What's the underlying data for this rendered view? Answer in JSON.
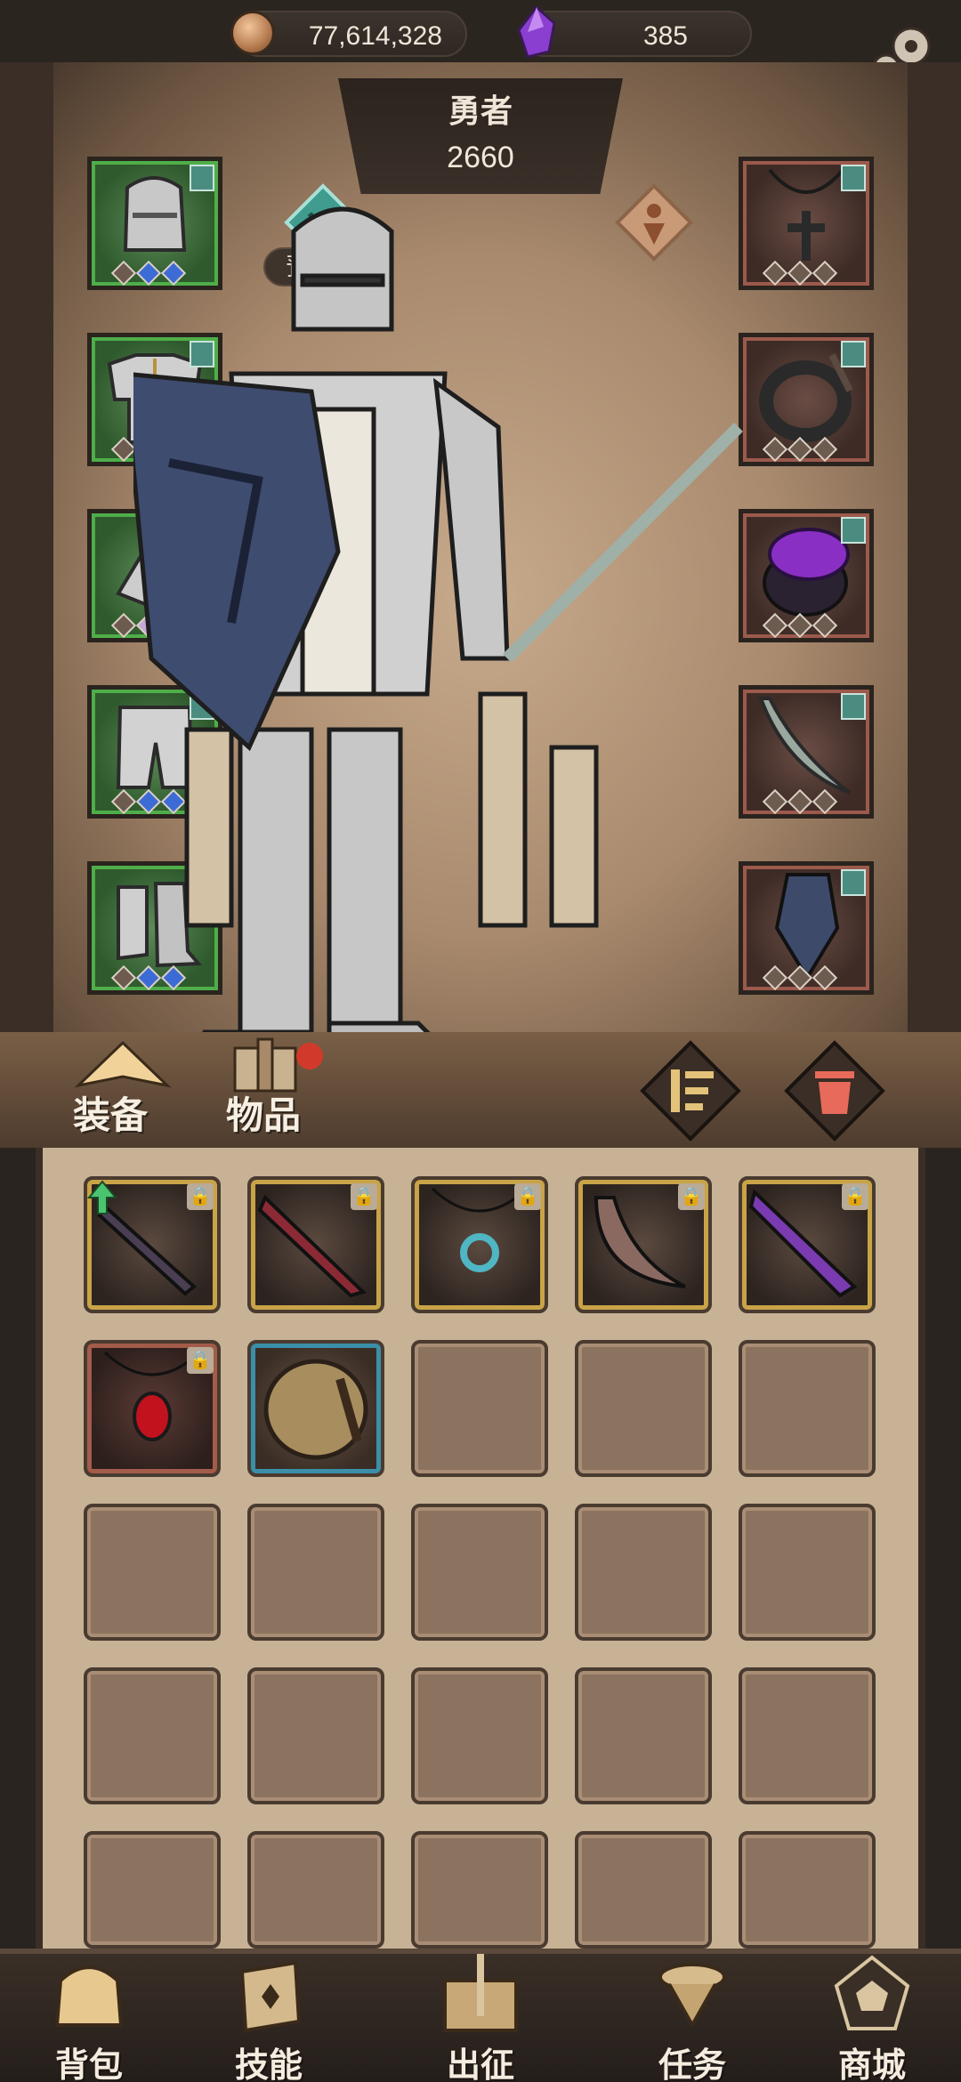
{
  "resources": {
    "gold": "77,614,328",
    "gems": "385"
  },
  "hero": {
    "name": "勇者",
    "power": "2660",
    "preset_label": "预设一"
  },
  "tabs": {
    "equip": "装备",
    "items": "物品"
  },
  "equipment_left": [
    "helmet-icon",
    "chest-armor-icon",
    "gauntlet-icon",
    "leg-armor-icon",
    "boots-icon"
  ],
  "equipment_right": [
    "cross-necklace-icon",
    "chain-ring-icon",
    "purple-gem-ring-icon",
    "curved-blade-icon",
    "shield-icon"
  ],
  "inventory": {
    "items": [
      "dark-sword-icon",
      "serrated-blade-icon",
      "moon-pendant-icon",
      "bloody-scythe-icon",
      "purple-dagger-icon",
      "ruby-pendant-icon",
      "leather-helmet-icon"
    ],
    "empty_slots": 18
  },
  "nav": {
    "bag": "背包",
    "skills": "技能",
    "expedition": "出征",
    "quests": "任务",
    "shop": "商城"
  },
  "colors": {
    "accent_green": "#4fae49",
    "accent_red": "#9b5a4c",
    "gold_frame": "#c9a347",
    "teal_frame": "#3b8fa8"
  }
}
